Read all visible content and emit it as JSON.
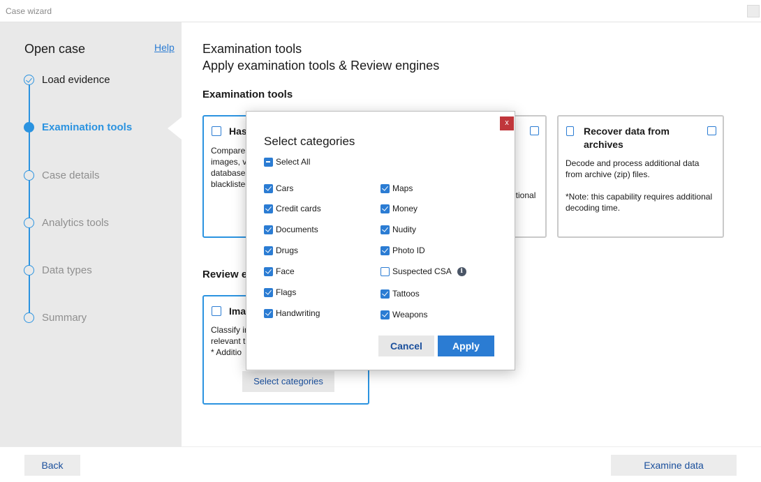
{
  "window": {
    "title": "Case wizard"
  },
  "sidebar": {
    "heading": "Open case",
    "help": "Help",
    "steps": [
      {
        "label": "Load evidence",
        "state": "done"
      },
      {
        "label": "Examination tools",
        "state": "active"
      },
      {
        "label": "Case details",
        "state": "pending"
      },
      {
        "label": "Analytics tools",
        "state": "pending"
      },
      {
        "label": "Data types",
        "state": "pending"
      },
      {
        "label": "Summary",
        "state": "pending"
      }
    ]
  },
  "main": {
    "title": "Examination tools",
    "subtitle": "Apply examination tools & Review engines",
    "exam_section": "Examination tools",
    "review_section": "Review e",
    "hash_card": {
      "title": "Has",
      "desc": [
        "Compares",
        "images, vi",
        "databases",
        "blacklisted"
      ]
    },
    "middle_card": {
      "desc_fragment": "itional"
    },
    "recover_card": {
      "title_line1": "Recover data from",
      "title_line2": "archives",
      "desc1_line1": "Decode and process additional data",
      "desc1_line2": "from archive (zip) files.",
      "desc2_line1": "*Note: this capability requires additional",
      "desc2_line2": "decoding time."
    },
    "image_card": {
      "title": "Ima",
      "desc": [
        "Classify in",
        "relevant t",
        "* Additio"
      ],
      "button": "Select categories"
    }
  },
  "footer": {
    "back": "Back",
    "examine": "Examine data"
  },
  "modal": {
    "close": "x",
    "title": "Select categories",
    "select_all": "Select All",
    "left": [
      {
        "label": "Cars",
        "checked": true
      },
      {
        "label": "Credit cards",
        "checked": true
      },
      {
        "label": "Documents",
        "checked": true
      },
      {
        "label": "Drugs",
        "checked": true
      },
      {
        "label": "Face",
        "checked": true
      },
      {
        "label": "Flags",
        "checked": true
      },
      {
        "label": "Handwriting",
        "checked": true
      }
    ],
    "right": [
      {
        "label": "Maps",
        "checked": true
      },
      {
        "label": "Money",
        "checked": true
      },
      {
        "label": "Nudity",
        "checked": true
      },
      {
        "label": "Photo ID",
        "checked": true
      },
      {
        "label": "Suspected CSA",
        "checked": false
      },
      {
        "label": "Tattoos",
        "checked": true
      },
      {
        "label": "Weapons",
        "checked": true
      }
    ],
    "info_glyph": "i",
    "cancel": "Cancel",
    "apply": "Apply"
  },
  "colors": {
    "accent": "#2b93e0",
    "button_text": "#1a4f9c",
    "close_red": "#c0363b"
  }
}
